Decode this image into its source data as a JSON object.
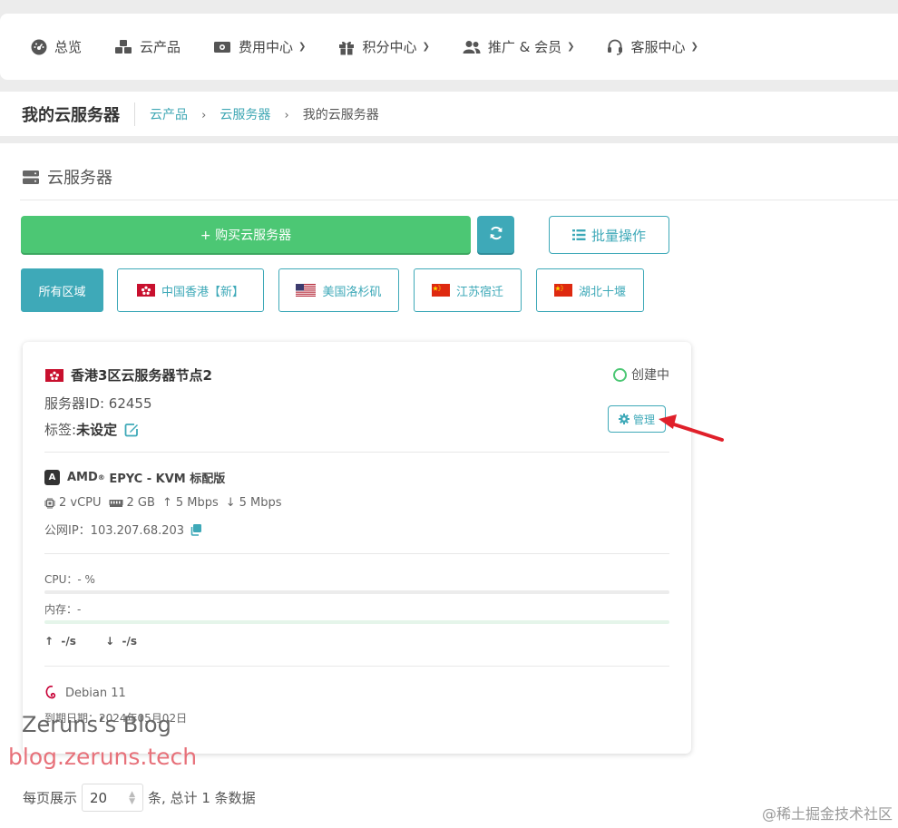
{
  "nav": {
    "items": [
      {
        "label": "总览",
        "icon": "dashboard-icon",
        "has_dropdown": false
      },
      {
        "label": "云产品",
        "icon": "cubes-icon",
        "has_dropdown": false
      },
      {
        "label": "费用中心",
        "icon": "money-icon",
        "has_dropdown": true
      },
      {
        "label": "积分中心",
        "icon": "gift-icon",
        "has_dropdown": true
      },
      {
        "label": "推广 & 会员",
        "icon": "users-icon",
        "has_dropdown": true
      },
      {
        "label": "客服中心",
        "icon": "headset-icon",
        "has_dropdown": true
      }
    ]
  },
  "breadcrumb": {
    "title": "我的云服务器",
    "items": [
      "云产品",
      "云服务器",
      "我的云服务器"
    ],
    "separator": "›"
  },
  "section": {
    "title": "云服务器",
    "buy_label": "+ 购买云服务器",
    "batch_label": "批量操作"
  },
  "regions": [
    {
      "label": "所有区域",
      "active": true,
      "flag": ""
    },
    {
      "label": "中国香港【新】",
      "active": false,
      "flag": "hk-flag-icon"
    },
    {
      "label": "美国洛杉矶",
      "active": false,
      "flag": "us-flag-icon"
    },
    {
      "label": "江苏宿迁",
      "active": false,
      "flag": "cn-flag-icon"
    },
    {
      "label": "湖北十堰",
      "active": false,
      "flag": "cn-flag-icon"
    }
  ],
  "server": {
    "name": "香港3区云服务器节点2",
    "status": "创建中",
    "id_label": "服务器ID: 62455",
    "tag_prefix": "标签:",
    "tag_value": "未设定",
    "manage_label": "管理",
    "cpu_brand": "AMD",
    "cpu_sup": "®",
    "cpu_rest": "EPYC - KVM 标配版",
    "vcpu": "2 vCPU",
    "ram": "2 GB",
    "up_bw": "5 Mbps",
    "down_bw": "5 Mbps",
    "ip": "公网IP：103.207.68.203",
    "cpu_usage": "CPU：- %",
    "mem_usage": "内存：-",
    "net_up": "-/s",
    "net_down": "-/s",
    "os": "Debian 11",
    "expire": "到期日期：2024年05月02日"
  },
  "pager": {
    "prefix": "每页展示",
    "page_size": "20",
    "suffix": "条, 总计 1 条数据"
  },
  "watermarks": {
    "blog_name": "Zeruns‘s Blog",
    "blog_url": "blog.zeruns.tech",
    "juejin": "@稀土掘金技术社区"
  },
  "colors": {
    "accent": "#3ea9b8",
    "buy_green": "#4cc774",
    "arrow_red": "#e0202a"
  }
}
